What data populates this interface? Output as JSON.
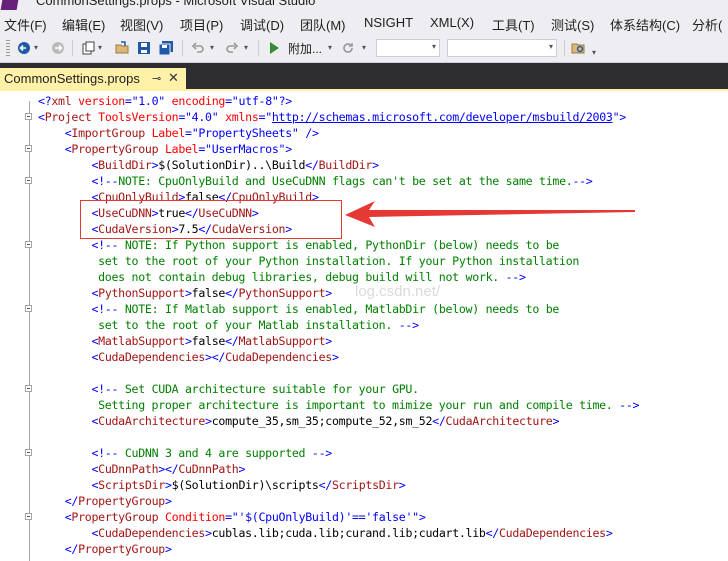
{
  "window": {
    "title": "CommonSettings.props - Microsoft Visual Studio"
  },
  "menu": [
    "文件(F)",
    "编辑(E)",
    "视图(V)",
    "项目(P)",
    "调试(D)",
    "团队(M)",
    "NSIGHT",
    "XML(X)",
    "工具(T)",
    "测试(S)",
    "体系结构(C)",
    "分析("
  ],
  "toolbar": {
    "attach_label": "附加...",
    "config_value": "",
    "platform_value": ""
  },
  "tab": {
    "label": "CommonSettings.props"
  },
  "watermark": "log.csdn.net/",
  "colors": {
    "highlight_box": "#e53935",
    "arrow": "#e53935",
    "tab_active": "#fff2a8"
  },
  "lines": [
    [
      "<?xml version=\"1.0\" encoding=\"utf-8\"?>"
    ],
    [
      "<Project ToolsVersion=\"4.0\" xmlns=\"http://schemas.microsoft.com/developer/msbuild/2003\">"
    ],
    [
      "    <ImportGroup Label=\"PropertySheets\" />"
    ],
    [
      "    <PropertyGroup Label=\"UserMacros\">"
    ],
    [
      "        <BuildDir>$(SolutionDir)..\\Build</BuildDir>"
    ],
    [
      "        <!--NOTE: CpuOnlyBuild and UseCuDNN flags can't be set at the same time.-->"
    ],
    [
      "        <CpuOnlyBuild>false</CpuOnlyBuild>"
    ],
    [
      "        <UseCuDNN>true</UseCuDNN>"
    ],
    [
      "        <CudaVersion>7.5</CudaVersion>"
    ],
    [
      "        <!-- NOTE: If Python support is enabled, PythonDir (below) needs to be"
    ],
    [
      "         set to the root of your Python installation. If your Python installation"
    ],
    [
      "         does not contain debug libraries, debug build will not work. -->"
    ],
    [
      "        <PythonSupport>false</PythonSupport>"
    ],
    [
      "        <!-- NOTE: If Matlab support is enabled, MatlabDir (below) needs to be"
    ],
    [
      "         set to the root of your Matlab installation. -->"
    ],
    [
      "        <MatlabSupport>false</MatlabSupport>"
    ],
    [
      "        <CudaDependencies></CudaDependencies>"
    ],
    [
      ""
    ],
    [
      "        <!-- Set CUDA architecture suitable for your GPU."
    ],
    [
      "         Setting proper architecture is important to mimize your run and compile time. -->"
    ],
    [
      "        <CudaArchitecture>compute_35,sm_35;compute_52,sm_52</CudaArchitecture>"
    ],
    [
      ""
    ],
    [
      "        <!-- CuDNN 3 and 4 are supported -->"
    ],
    [
      "        <CuDnnPath></CuDnnPath>"
    ],
    [
      "        <ScriptsDir>$(SolutionDir)\\scripts</ScriptsDir>"
    ],
    [
      "    </PropertyGroup>"
    ],
    [
      "    <PropertyGroup Condition=\"'$(CpuOnlyBuild)'=='false'\">"
    ],
    [
      "        <CudaDependencies>cublas.lib;cuda.lib;curand.lib;cudart.lib</CudaDependencies>"
    ],
    [
      "    </PropertyGroup>"
    ]
  ]
}
